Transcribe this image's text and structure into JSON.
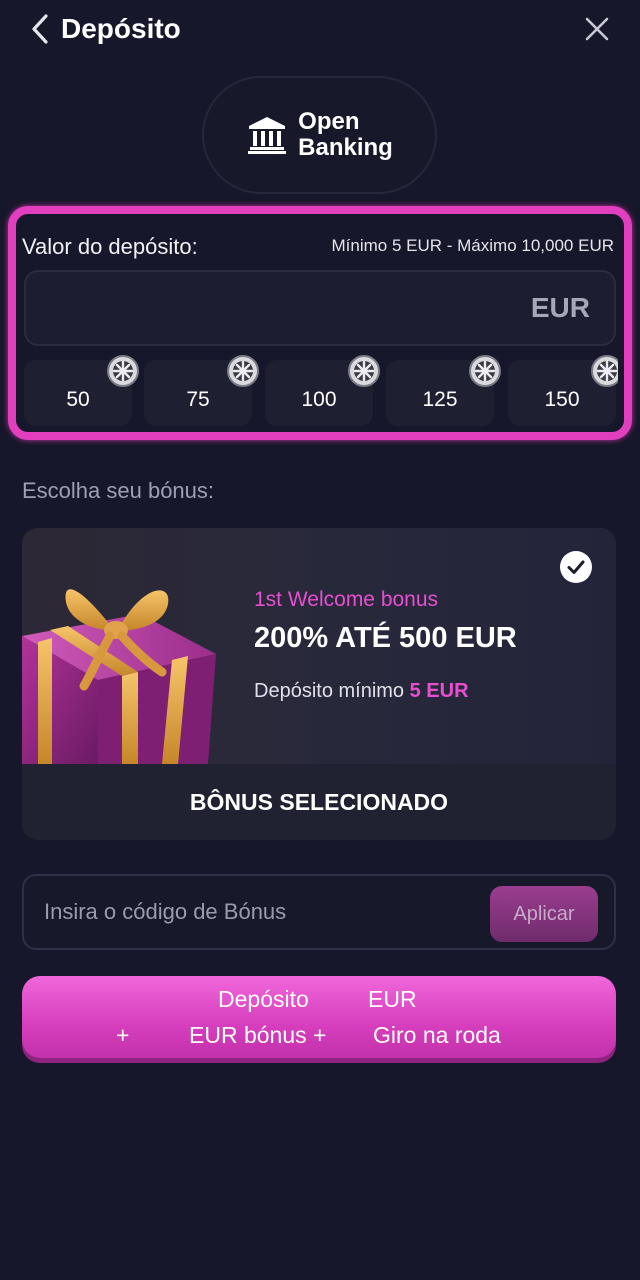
{
  "header": {
    "title": "Depósito",
    "back_icon": "chevron-left-icon",
    "close_icon": "close-icon"
  },
  "payment_method": {
    "label": "Open\nBanking",
    "icon": "bank-icon"
  },
  "amount": {
    "label": "Valor do depósito:",
    "limits": "Mínimo 5 EUR - Máximo 10,000 EUR",
    "value": "",
    "currency": "EUR",
    "quick_amounts": [
      "50",
      "75",
      "100",
      "125",
      "150"
    ],
    "quick_amount_icon": "coin-icon"
  },
  "bonus": {
    "section_label": "Escolha seu bónus:",
    "card": {
      "kicker": "1st Welcome bonus",
      "title": "200% ATÉ 500 EUR",
      "min_label": "Depósito mínimo",
      "min_value": "5 EUR",
      "status": "BÔNUS SELECIONADO",
      "selected": true
    }
  },
  "promo_code": {
    "placeholder": "Insira o código de Bónus",
    "value": "",
    "apply_label": "Aplicar"
  },
  "deposit_button": {
    "line1_prefix": "Depósito",
    "line1_suffix": "EUR",
    "plus": "+",
    "line2_bonus": "EUR bónus +",
    "line2_wheel": "Giro na roda"
  },
  "colors": {
    "background": "#16172a",
    "accent": "#e13fbe",
    "accent_text": "#e84fd0",
    "card": "#232433"
  }
}
